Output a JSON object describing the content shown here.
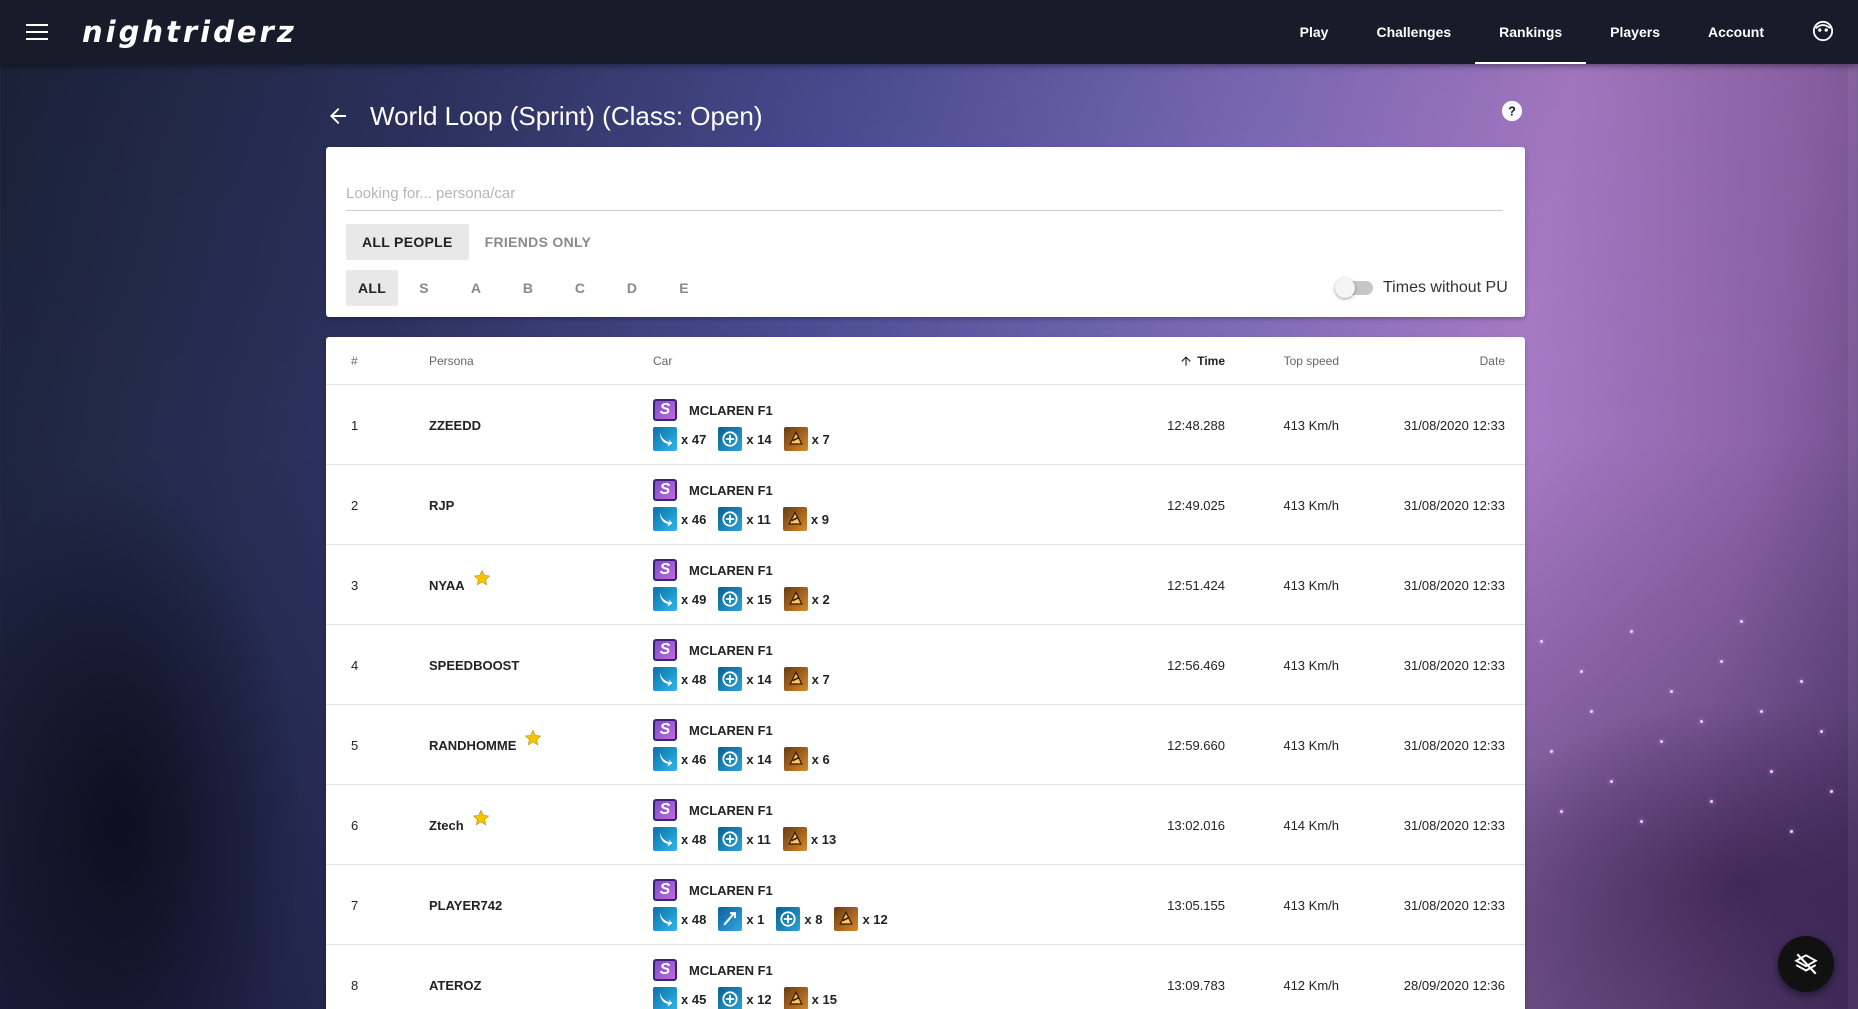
{
  "app": {
    "logo": "nightriderz"
  },
  "nav": [
    {
      "label": "Play",
      "active": false
    },
    {
      "label": "Challenges",
      "active": false
    },
    {
      "label": "Rankings",
      "active": true
    },
    {
      "label": "Players",
      "active": false
    },
    {
      "label": "Account",
      "active": false
    }
  ],
  "page": {
    "title": "World Loop (Sprint) (Class: Open)"
  },
  "filters": {
    "search_placeholder": "Looking for... persona/car",
    "people_tabs": [
      {
        "label": "ALL PEOPLE",
        "active": true
      },
      {
        "label": "FRIENDS ONLY",
        "active": false
      }
    ],
    "class_tabs": [
      {
        "label": "ALL",
        "active": true
      },
      {
        "label": "S",
        "active": false
      },
      {
        "label": "A",
        "active": false
      },
      {
        "label": "B",
        "active": false
      },
      {
        "label": "C",
        "active": false
      },
      {
        "label": "D",
        "active": false
      },
      {
        "label": "E",
        "active": false
      }
    ],
    "times_without_pu": {
      "label": "Times without PU",
      "enabled": false
    }
  },
  "table": {
    "headers": {
      "rank": "#",
      "persona": "Persona",
      "car": "Car",
      "time": "Time",
      "top_speed": "Top speed",
      "date": "Date"
    },
    "sort": {
      "column": "time",
      "direction": "ascending"
    },
    "rows": [
      {
        "rank": "1",
        "persona": "ZZEEDD",
        "starred": false,
        "car_class": "S",
        "car": "MCLAREN F1",
        "powerups": [
          {
            "icon": "nitrous-icon",
            "count": "x 47"
          },
          {
            "icon": "shield-icon",
            "count": "x 14"
          },
          {
            "icon": "juggernaut-icon",
            "count": "x 7"
          }
        ],
        "time": "12:48.288",
        "top_speed": "413 Km/h",
        "date": "31/08/2020 12:33"
      },
      {
        "rank": "2",
        "persona": "RJP",
        "starred": false,
        "car_class": "S",
        "car": "MCLAREN F1",
        "powerups": [
          {
            "icon": "nitrous-icon",
            "count": "x 46"
          },
          {
            "icon": "shield-icon",
            "count": "x 11"
          },
          {
            "icon": "juggernaut-icon",
            "count": "x 9"
          }
        ],
        "time": "12:49.025",
        "top_speed": "413 Km/h",
        "date": "31/08/2020 12:33"
      },
      {
        "rank": "3",
        "persona": "NYAA",
        "starred": true,
        "car_class": "S",
        "car": "MCLAREN F1",
        "powerups": [
          {
            "icon": "nitrous-icon",
            "count": "x 49"
          },
          {
            "icon": "shield-icon",
            "count": "x 15"
          },
          {
            "icon": "juggernaut-icon",
            "count": "x 2"
          }
        ],
        "time": "12:51.424",
        "top_speed": "413 Km/h",
        "date": "31/08/2020 12:33"
      },
      {
        "rank": "4",
        "persona": "SPEEDBOOST",
        "starred": false,
        "car_class": "S",
        "car": "MCLAREN F1",
        "powerups": [
          {
            "icon": "nitrous-icon",
            "count": "x 48"
          },
          {
            "icon": "shield-icon",
            "count": "x 14"
          },
          {
            "icon": "juggernaut-icon",
            "count": "x 7"
          }
        ],
        "time": "12:56.469",
        "top_speed": "413 Km/h",
        "date": "31/08/2020 12:33"
      },
      {
        "rank": "5",
        "persona": "RANDHOMME",
        "starred": true,
        "car_class": "S",
        "car": "MCLAREN F1",
        "powerups": [
          {
            "icon": "nitrous-icon",
            "count": "x 46"
          },
          {
            "icon": "shield-icon",
            "count": "x 14"
          },
          {
            "icon": "juggernaut-icon",
            "count": "x 6"
          }
        ],
        "time": "12:59.660",
        "top_speed": "413 Km/h",
        "date": "31/08/2020 12:33"
      },
      {
        "rank": "6",
        "persona": "Ztech",
        "starred": true,
        "car_class": "S",
        "car": "MCLAREN F1",
        "powerups": [
          {
            "icon": "nitrous-icon",
            "count": "x 48"
          },
          {
            "icon": "shield-icon",
            "count": "x 11"
          },
          {
            "icon": "juggernaut-icon",
            "count": "x 13"
          }
        ],
        "time": "13:02.016",
        "top_speed": "414 Km/h",
        "date": "31/08/2020 12:33"
      },
      {
        "rank": "7",
        "persona": "PLAYER742",
        "starred": false,
        "car_class": "S",
        "car": "MCLAREN F1",
        "powerups": [
          {
            "icon": "nitrous-icon",
            "count": "x 48"
          },
          {
            "icon": "ram-icon",
            "count": "x 1"
          },
          {
            "icon": "shield-icon",
            "count": "x 8"
          },
          {
            "icon": "juggernaut-icon",
            "count": "x 12"
          }
        ],
        "time": "13:05.155",
        "top_speed": "413 Km/h",
        "date": "31/08/2020 12:33"
      },
      {
        "rank": "8",
        "persona": "ATEROZ",
        "starred": false,
        "car_class": "S",
        "car": "MCLAREN F1",
        "powerups": [
          {
            "icon": "nitrous-icon",
            "count": "x 45"
          },
          {
            "icon": "shield-icon",
            "count": "x 12"
          },
          {
            "icon": "juggernaut-icon",
            "count": "x 15"
          }
        ],
        "time": "13:09.783",
        "top_speed": "412 Km/h",
        "date": "28/09/2020 12:36"
      }
    ]
  },
  "colors": {
    "topbar": "#171b2a",
    "accent": "#ffffff",
    "class_badge": "#7a4ec8",
    "star": "#f4c400"
  }
}
